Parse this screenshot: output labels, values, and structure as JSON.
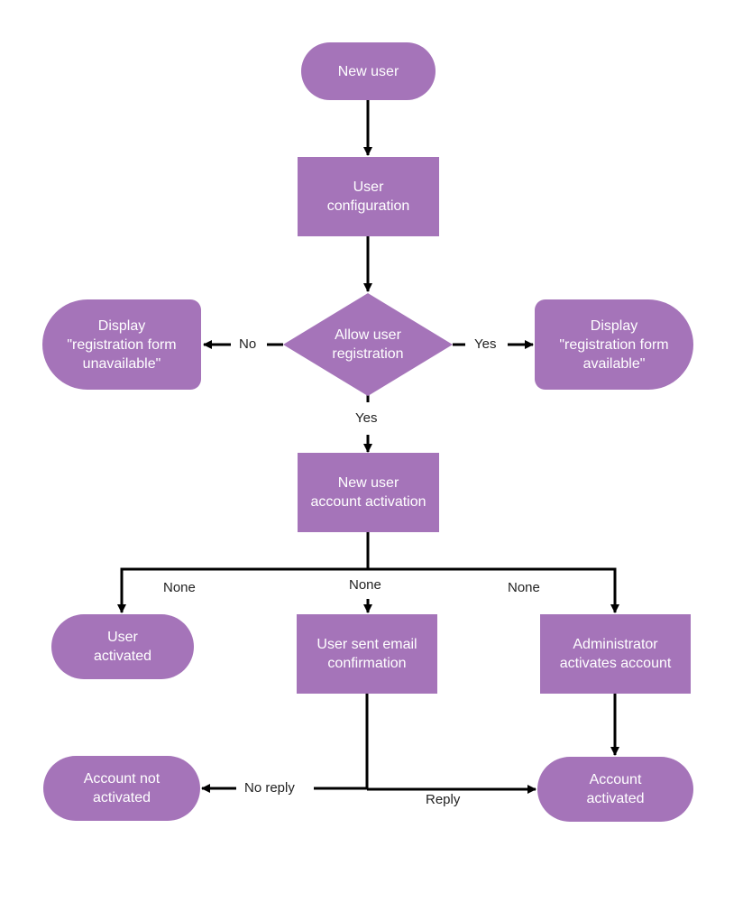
{
  "diagram": {
    "type": "flowchart",
    "colors": {
      "node_fill": "#a574b9",
      "node_text": "#ffffff",
      "edge": "#000000",
      "label_text": "#222222"
    },
    "nodes": {
      "new_user": "New user",
      "user_configuration": "User\nconfiguration",
      "allow_registration": "Allow user\nregistration",
      "form_unavailable": "Display\n\"registration form\nunavailable\"",
      "form_available": "Display\n\"registration form\navailable\"",
      "new_account_activation": "New user\naccount activation",
      "user_activated": "User\nactivated",
      "email_confirmation": "User sent email\nconfirmation",
      "admin_activates": "Administrator\nactivates account",
      "account_not_activated": "Account not\nactivated",
      "account_activated": "Account\nactivated"
    },
    "edge_labels": {
      "no": "No",
      "yes_right": "Yes",
      "yes_down": "Yes",
      "none_left": "None",
      "none_middle": "None",
      "none_right": "None",
      "no_reply": "No reply",
      "reply": "Reply"
    },
    "edges": [
      {
        "from": "new_user",
        "to": "user_configuration"
      },
      {
        "from": "user_configuration",
        "to": "allow_registration"
      },
      {
        "from": "allow_registration",
        "to": "form_unavailable",
        "label": "No"
      },
      {
        "from": "allow_registration",
        "to": "form_available",
        "label": "Yes"
      },
      {
        "from": "allow_registration",
        "to": "new_account_activation",
        "label": "Yes"
      },
      {
        "from": "new_account_activation",
        "to": "user_activated",
        "label": "None"
      },
      {
        "from": "new_account_activation",
        "to": "email_confirmation",
        "label": "None"
      },
      {
        "from": "new_account_activation",
        "to": "admin_activates",
        "label": "None"
      },
      {
        "from": "email_confirmation",
        "to": "account_not_activated",
        "label": "No reply"
      },
      {
        "from": "email_confirmation",
        "to": "account_activated",
        "label": "Reply"
      },
      {
        "from": "admin_activates",
        "to": "account_activated"
      }
    ]
  }
}
